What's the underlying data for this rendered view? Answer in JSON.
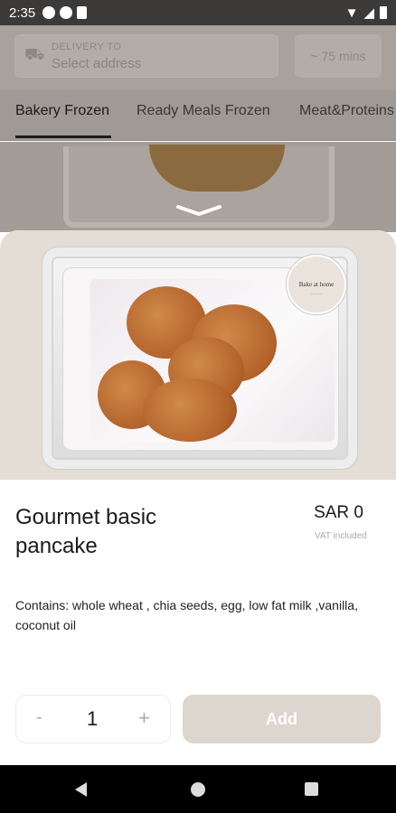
{
  "status_bar": {
    "time": "2:35"
  },
  "background": {
    "delivery_label": "DELIVERY TO",
    "delivery_value": "Select address",
    "eta": "~ 75 mins",
    "tabs": [
      "Bakery Frozen",
      "Ready Meals Frozen",
      "Meat&Proteins"
    ]
  },
  "product": {
    "seal_text": "Bake at home",
    "title": "Gourmet basic pancake",
    "price": "SAR 0",
    "vat_note": "VAT included",
    "description": "Contains: whole wheat , chia seeds, egg, low fat milk ,vanilla, coconut oil"
  },
  "cart": {
    "minus_label": "-",
    "quantity": "1",
    "plus_label": "+",
    "add_label": "Add"
  },
  "colors": {
    "sheet_hero_bg": "#e4ddd6",
    "add_button_bg": "#ddd6cf"
  }
}
